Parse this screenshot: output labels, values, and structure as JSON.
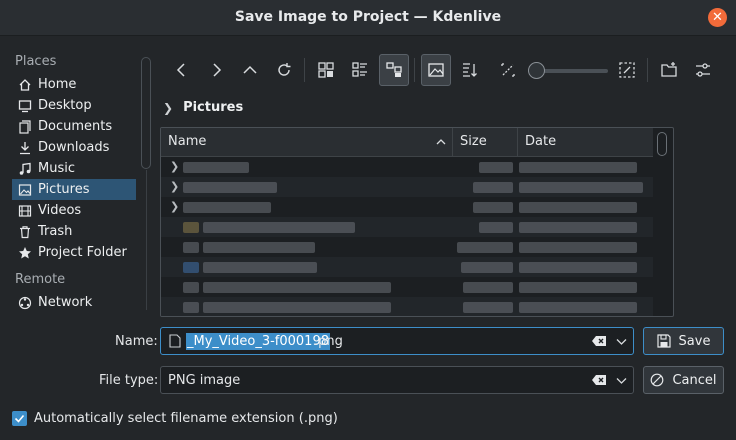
{
  "window": {
    "title": "Save Image to Project — Kdenlive"
  },
  "sidebar": {
    "places_heading": "Places",
    "items": [
      {
        "label": "Home",
        "icon": "home-icon"
      },
      {
        "label": "Desktop",
        "icon": "desktop-icon"
      },
      {
        "label": "Documents",
        "icon": "documents-icon"
      },
      {
        "label": "Downloads",
        "icon": "downloads-icon"
      },
      {
        "label": "Music",
        "icon": "music-icon"
      },
      {
        "label": "Pictures",
        "icon": "pictures-icon",
        "selected": true
      },
      {
        "label": "Videos",
        "icon": "videos-icon"
      },
      {
        "label": "Trash",
        "icon": "trash-icon"
      },
      {
        "label": "Project Folder",
        "icon": "star-icon"
      }
    ],
    "remote_heading": "Remote",
    "remote_items": [
      {
        "label": "Network",
        "icon": "network-icon"
      }
    ]
  },
  "toolbar": {
    "buttons": [
      "back-icon",
      "forward-icon",
      "up-icon",
      "reload-icon",
      "icons-view-icon",
      "details-view-icon",
      "tree-view-icon",
      "preview-icon",
      "sort-icon",
      "zoom-out-icon",
      "zoom-in-icon",
      "new-folder-icon",
      "options-icon"
    ]
  },
  "breadcrumb": {
    "current": "Pictures"
  },
  "file_list": {
    "columns": [
      "Name",
      "Size",
      "Date"
    ],
    "sort_indicator": "ascending",
    "row_count_visible": 8
  },
  "name_field": {
    "label": "Name:",
    "selected_text": "_My_Video_3-f000198",
    "extension": ".png"
  },
  "filetype_field": {
    "label": "File type:",
    "value": "PNG image"
  },
  "buttons": {
    "save": "Save",
    "cancel": "Cancel"
  },
  "auto_extension": {
    "checked": true,
    "label": "Automatically select filename extension (.png)"
  },
  "colors": {
    "accent": "#3d8ec9",
    "selection": "#2d5575",
    "close": "#f26b3a",
    "background": "#232629"
  }
}
